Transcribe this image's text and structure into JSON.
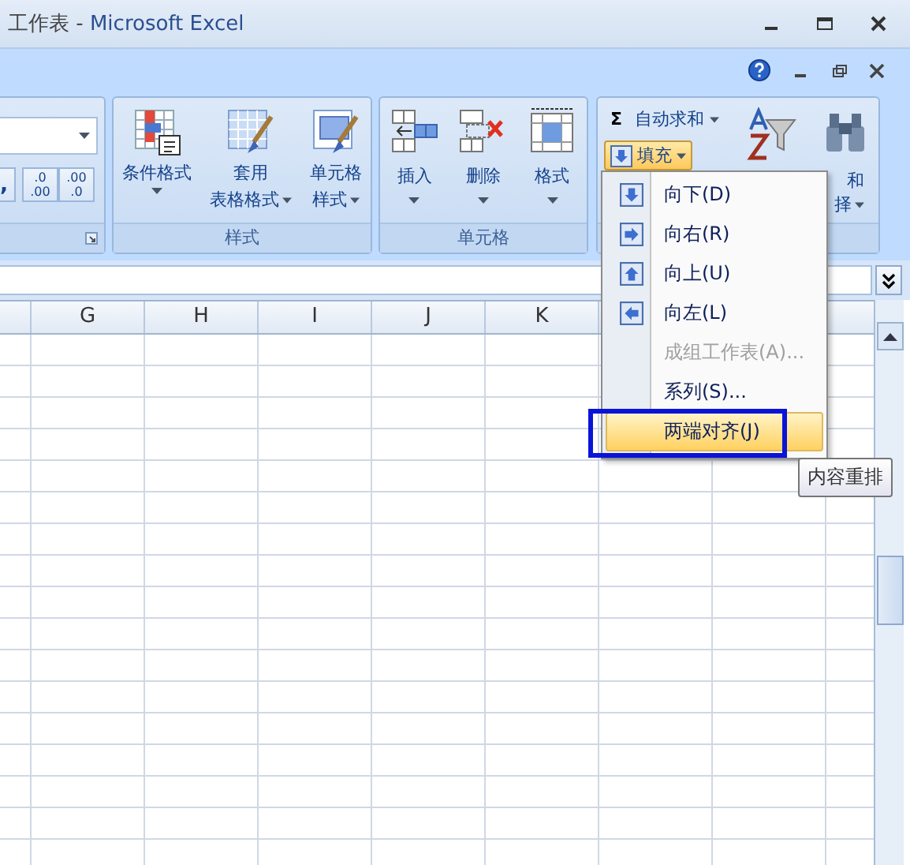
{
  "window": {
    "title_prefix": "工作表 - ",
    "title_app": "Microsoft Excel"
  },
  "ribbon": {
    "styles_group": {
      "label": "样式",
      "buttons": [
        {
          "kind": "cond",
          "lines": [
            "条件格式"
          ],
          "caret_below": true
        },
        {
          "kind": "table",
          "lines": [
            "套用",
            "表格格式"
          ],
          "caret_below": false
        },
        {
          "kind": "cellstyle",
          "lines": [
            "单元格",
            "样式"
          ],
          "caret_below": false
        }
      ]
    },
    "cells_group": {
      "label": "单元格",
      "buttons": [
        {
          "kind": "insert",
          "lines": [
            "插入"
          ]
        },
        {
          "kind": "delete",
          "lines": [
            "删除"
          ]
        },
        {
          "kind": "format",
          "lines": [
            "格式"
          ]
        }
      ]
    },
    "editing_group": {
      "autosum": "自动求和",
      "sigma": "Σ",
      "fill": {
        "label": "填充",
        "selected": true
      },
      "find_lines": [
        "和",
        "择"
      ]
    },
    "number_group": {
      "comma": ",",
      "inc": ".0",
      "inc2": ".00",
      "dec": ".00",
      "dec2": ".0"
    }
  },
  "columns": [
    "G",
    "H",
    "I",
    "J",
    "K"
  ],
  "fill_menu": {
    "items": [
      {
        "label": "向下(D)",
        "kind": "down",
        "disabled": false,
        "selected": false
      },
      {
        "label": "向右(R)",
        "kind": "right",
        "disabled": false,
        "selected": false
      },
      {
        "label": "向上(U)",
        "kind": "up",
        "disabled": false,
        "selected": false
      },
      {
        "label": "向左(L)",
        "kind": "left",
        "disabled": false,
        "selected": false
      },
      {
        "label": "成组工作表(A)...",
        "kind": "text",
        "disabled": true,
        "selected": false
      },
      {
        "label": "系列(S)...",
        "kind": "text",
        "disabled": false,
        "selected": false
      },
      {
        "label": "两端对齐(J)",
        "kind": "text",
        "disabled": false,
        "selected": true
      }
    ]
  },
  "tooltip": "内容重排"
}
